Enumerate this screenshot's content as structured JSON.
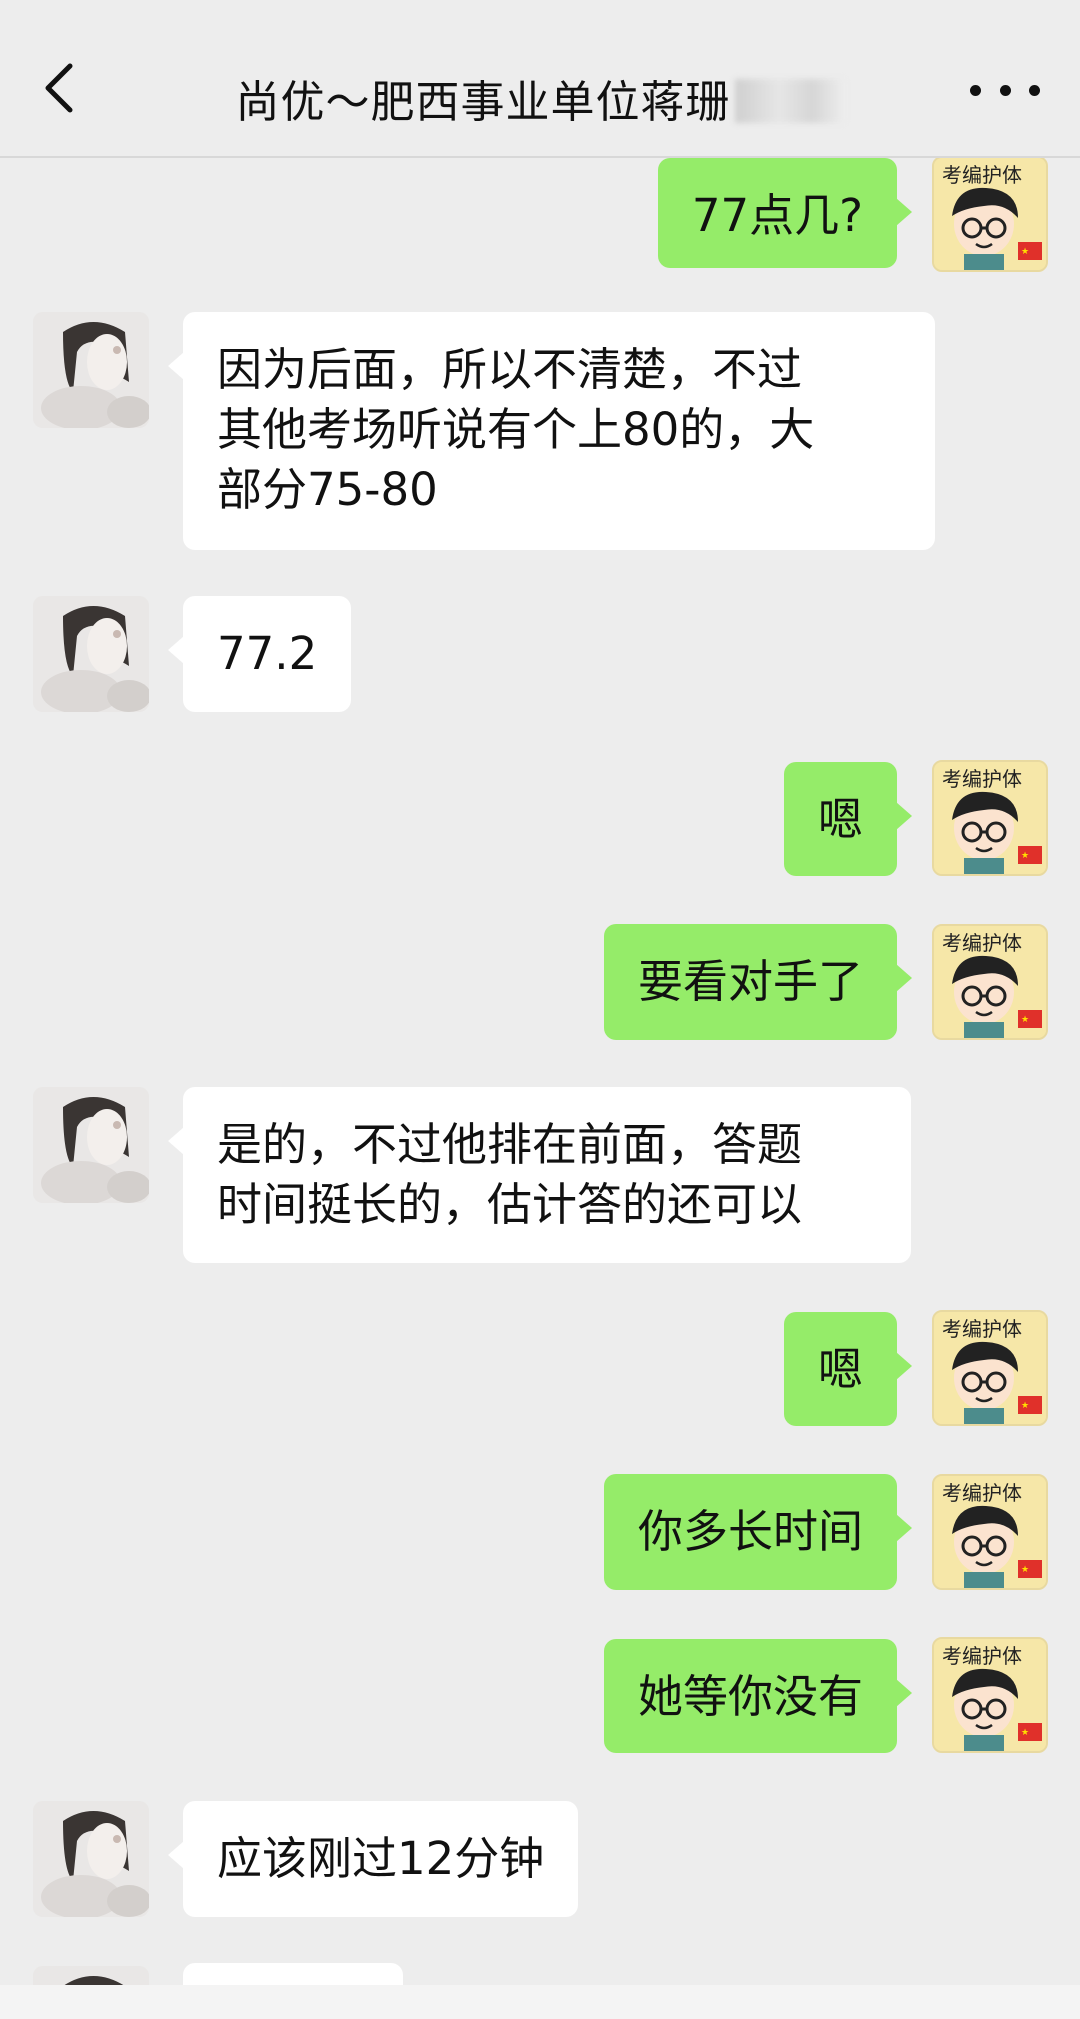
{
  "header": {
    "title": "尚优～肥西事业单位蒋珊",
    "back_icon": "chevron-left-icon",
    "more_icon": "more-dots-icon"
  },
  "avatars": {
    "left": "female-cartoon-avatar-icon",
    "right": "kaobian-boy-sticker-avatar-icon",
    "right_sticker_text": "考编护体"
  },
  "colors": {
    "background": "#ededed",
    "sent_bubble": "#95ec69",
    "received_bubble": "#ffffff",
    "text": "#111111"
  },
  "messages": [
    {
      "side": "right",
      "text": "77点几?"
    },
    {
      "side": "left",
      "text": "因为后面，所以不清楚，不过\n其他考场听说有个上80的，大\n部分75-80"
    },
    {
      "side": "left",
      "text": "77.2"
    },
    {
      "side": "right",
      "text": "嗯"
    },
    {
      "side": "right",
      "text": "要看对手了"
    },
    {
      "side": "left",
      "text": "是的，不过他排在前面，答题\n时间挺长的，估计答的还可以"
    },
    {
      "side": "right",
      "text": "嗯"
    },
    {
      "side": "right",
      "text": "你多长时间"
    },
    {
      "side": "right",
      "text": "她等你没有"
    },
    {
      "side": "left",
      "text": "应该刚过12分钟"
    }
  ]
}
